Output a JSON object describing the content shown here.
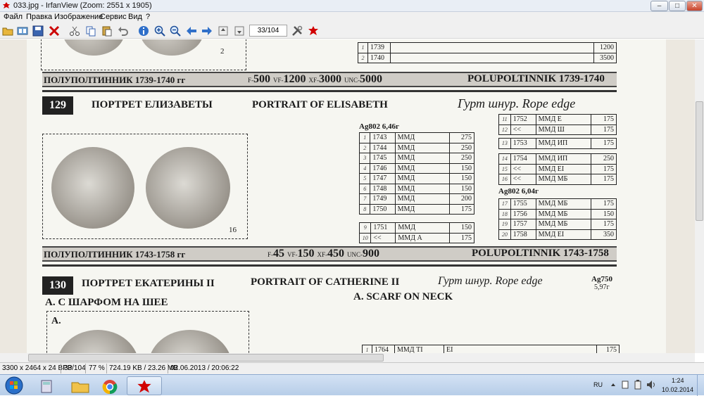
{
  "window": {
    "title": "033.jpg - IrfanView (Zoom: 2551 x 1905)",
    "controls": {
      "minimize": "–",
      "maximize": "□",
      "close": "✕"
    }
  },
  "menu": {
    "items": [
      "Файл",
      "Правка",
      "Изображение",
      "Сервис",
      "Вид",
      "?"
    ]
  },
  "toolbar": {
    "page_counter": "33/104",
    "icons": [
      "open-folder-icon",
      "thumbnails-icon",
      "save-icon",
      "delete-icon",
      "cut-icon",
      "copy-icon",
      "paste-icon",
      "undo-icon",
      "info-icon",
      "zoom-in-icon",
      "zoom-out-icon",
      "prev-icon",
      "next-icon",
      "first-page-icon",
      "last-page-icon",
      "settings-icon",
      "irfanview-icon"
    ]
  },
  "doc": {
    "top": {
      "coin_number": "2",
      "rows": [
        {
          "n": "1",
          "year": "1739",
          "price": "1200"
        },
        {
          "n": "2",
          "year": "1740",
          "price": "3500"
        }
      ],
      "band_ru": "ПОЛУПОЛТИННИК 1739-1740 гг",
      "band_prices": [
        {
          "grade": "F-",
          "value": "500"
        },
        {
          "grade": "VF-",
          "value": "1200"
        },
        {
          "grade": "XF-",
          "value": "3000"
        },
        {
          "grade": "UNC-",
          "value": "5000"
        }
      ],
      "band_en": "POLUPOLTINNIK 1739-1740"
    },
    "s129": {
      "num": "129",
      "title_ru": "ПОРТРЕТ ЕЛИЗАВЕТЫ",
      "title_en": "PORTRAIT OF ELISABETH",
      "edge": "Гурт шнур.  Rope edge",
      "coin_number": "16",
      "spec1": "Ag802 6,46г",
      "spec2": "Ag802 6,04г",
      "left_rows": [
        {
          "n": "1",
          "year": "1743",
          "mint": "ММД",
          "price": "275"
        },
        {
          "n": "2",
          "year": "1744",
          "mint": "ММД",
          "price": "250"
        },
        {
          "n": "3",
          "year": "1745",
          "mint": "ММД",
          "price": "250"
        },
        {
          "n": "4",
          "year": "1746",
          "mint": "ММД",
          "price": "150"
        },
        {
          "n": "5",
          "year": "1747",
          "mint": "ММД",
          "price": "150"
        },
        {
          "n": "6",
          "year": "1748",
          "mint": "ММД",
          "price": "150"
        },
        {
          "n": "7",
          "year": "1749",
          "mint": "ММД",
          "price": "200"
        },
        {
          "n": "8",
          "year": "1750",
          "mint": "ММД",
          "price": "175"
        }
      ],
      "left_rows2": [
        {
          "n": "9",
          "year": "1751",
          "mint": "ММД",
          "price": "150"
        },
        {
          "n": "10",
          "year": "<<",
          "mint": "ММД   А",
          "price": "175"
        }
      ],
      "right_rows": [
        {
          "n": "11",
          "year": "1752",
          "mint": "ММД   Е",
          "price": "175"
        },
        {
          "n": "12",
          "year": "<<",
          "mint": "ММД   Ш",
          "price": "175"
        }
      ],
      "right_rows2": [
        {
          "n": "13",
          "year": "1753",
          "mint": "ММД   ИП",
          "price": "175"
        }
      ],
      "right_rows3": [
        {
          "n": "14",
          "year": "1754",
          "mint": "ММД   ИП",
          "price": "250"
        },
        {
          "n": "15",
          "year": "<<",
          "mint": "ММД   ЕI",
          "price": "175"
        },
        {
          "n": "16",
          "year": "<<",
          "mint": "ММД   МБ",
          "price": "175"
        }
      ],
      "right_rows4": [
        {
          "n": "17",
          "year": "1755",
          "mint": "ММД   МБ",
          "price": "175"
        },
        {
          "n": "18",
          "year": "1756",
          "mint": "ММД   МБ",
          "price": "150"
        },
        {
          "n": "19",
          "year": "1757",
          "mint": "ММД   МБ",
          "price": "175"
        },
        {
          "n": "20",
          "year": "1758",
          "mint": "ММД   ЕI",
          "price": "350"
        }
      ],
      "band_ru": "ПОЛУПОЛТИННИК 1743-1758 гг",
      "band_prices": [
        {
          "grade": "F-",
          "value": "45"
        },
        {
          "grade": "VF-",
          "value": "150"
        },
        {
          "grade": "XF-",
          "value": "450"
        },
        {
          "grade": "UNC-",
          "value": "900"
        }
      ],
      "band_en": "POLUPOLTINNIK 1743-1758"
    },
    "s130": {
      "num": "130",
      "title_ru": "ПОРТРЕТ ЕКАТЕРИНЫ II",
      "title_en": "PORTRAIT OF CATHERINE II",
      "edge": "Гурт шнур. Rope edge",
      "spec_metal": "Ag750",
      "spec_weight": "5,97г",
      "sub_ru": "А. С ШАРФОМ НА ШЕЕ",
      "sub_en": "A. SCARF ON NECK",
      "box_label": "A.",
      "row": {
        "n": "1",
        "year": "1764",
        "mint": "ММД ТI",
        "extra": "EI",
        "price": "175"
      }
    }
  },
  "status": {
    "dims": "3300 x 2464 x 24 BPP",
    "page": "33/104",
    "zoom": "77 %",
    "size": "724.19 KB / 23.26 MB",
    "datetime": "02.06.2013 / 20:06:22"
  },
  "taskbar": {
    "lang": "RU",
    "time": "1:24",
    "date": "10.02.2014"
  },
  "colors": {
    "accent": "#c8102e",
    "band": "#cfccc6",
    "taskbar": "#c4d7ee"
  }
}
